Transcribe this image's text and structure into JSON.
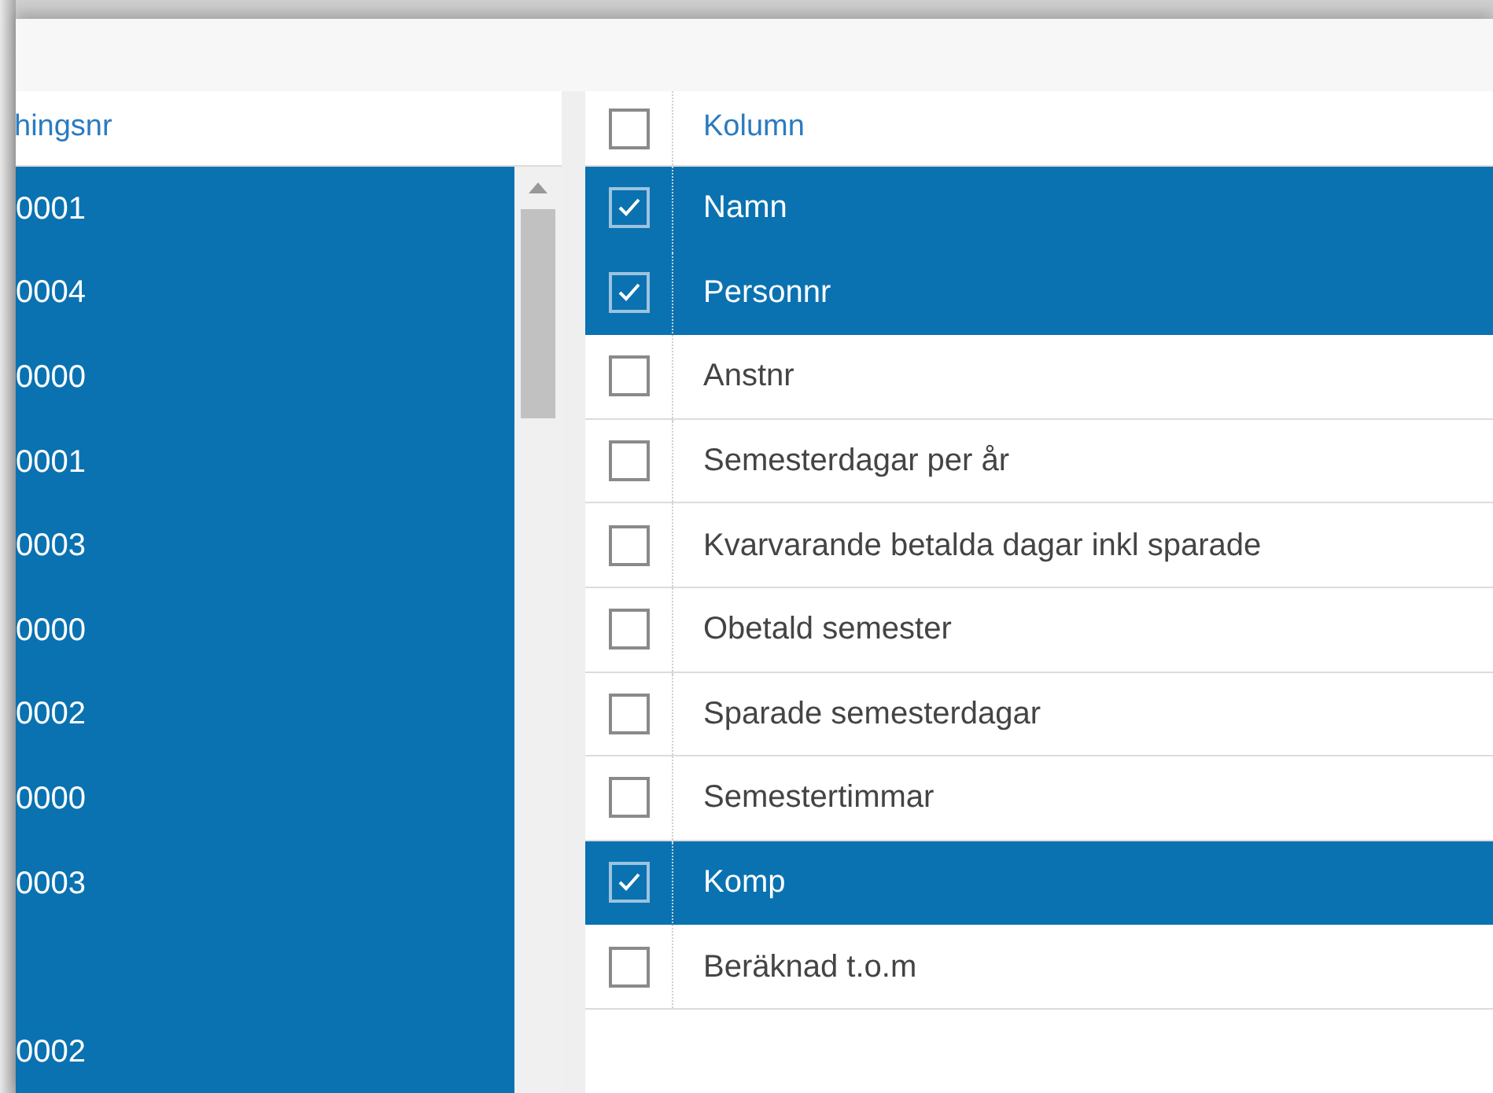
{
  "left_panel": {
    "header": "hingsnr",
    "rows": [
      {
        "value": "0001",
        "selected": true
      },
      {
        "value": "0004",
        "selected": true
      },
      {
        "value": "0000",
        "selected": true
      },
      {
        "value": "0001",
        "selected": true
      },
      {
        "value": "0003",
        "selected": true
      },
      {
        "value": "0000",
        "selected": true
      },
      {
        "value": "0002",
        "selected": true
      },
      {
        "value": "0000",
        "selected": true
      },
      {
        "value": "0003",
        "selected": true
      },
      {
        "selected": true
      },
      {
        "value": "0002",
        "selected": true
      }
    ]
  },
  "column_picker": {
    "header": {
      "label": "Kolumn",
      "checked": false
    },
    "rows": [
      {
        "label": "Namn",
        "checked": true,
        "selected": true
      },
      {
        "label": "Personnr",
        "checked": true,
        "selected": true
      },
      {
        "label": "Anstnr",
        "checked": false,
        "selected": false
      },
      {
        "label": "Semesterdagar per år",
        "checked": false,
        "selected": false
      },
      {
        "label": "Kvarvarande betalda dagar inkl sparade",
        "checked": false,
        "selected": false
      },
      {
        "label": "Obetald semester",
        "checked": false,
        "selected": false
      },
      {
        "label": "Sparade semesterdagar",
        "checked": false,
        "selected": false
      },
      {
        "label": "Semestertimmar",
        "checked": false,
        "selected": false
      },
      {
        "label": "Komp",
        "checked": true,
        "selected": true
      },
      {
        "label": "Beräknad t.o.m",
        "checked": false,
        "selected": false
      }
    ]
  }
}
